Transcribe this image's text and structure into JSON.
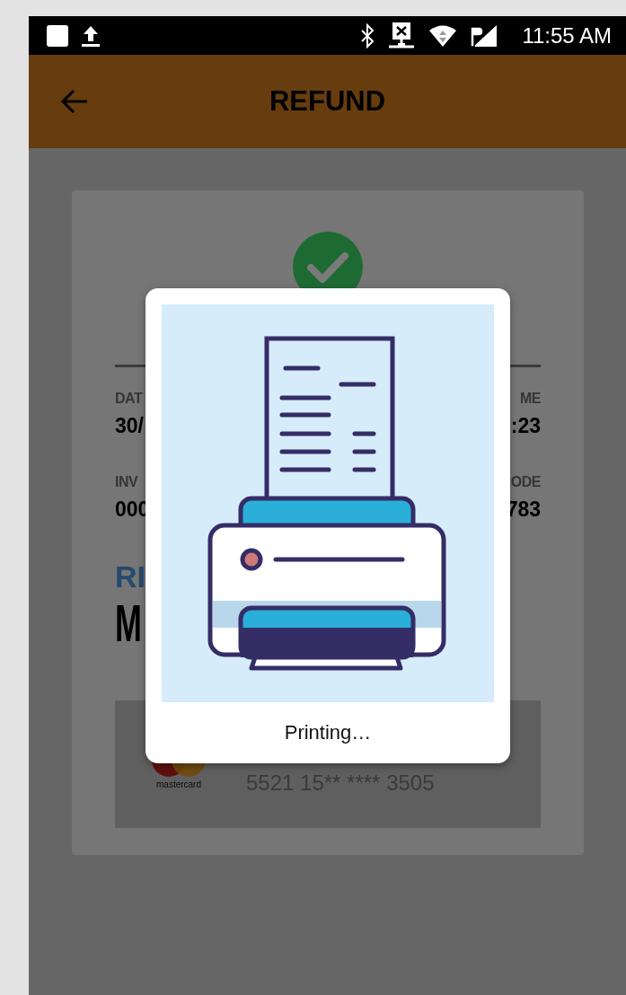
{
  "status_bar": {
    "time": "11:55 AM"
  },
  "app_bar": {
    "title": "REFUND"
  },
  "receipt": {
    "detail_rows": [
      {
        "left": {
          "label": "DAT",
          "value": "30/"
        },
        "right": {
          "label": "ME",
          "value": ":23"
        }
      },
      {
        "left": {
          "label": "INV",
          "value": "000"
        },
        "right": {
          "label": "ODE",
          "value": "783"
        }
      }
    ],
    "type_label": "RI",
    "amount": "M",
    "payment": {
      "brand": "mastercard",
      "card_number": "5521 15** **** 3505"
    }
  },
  "dialog": {
    "message": "Printing…"
  }
}
